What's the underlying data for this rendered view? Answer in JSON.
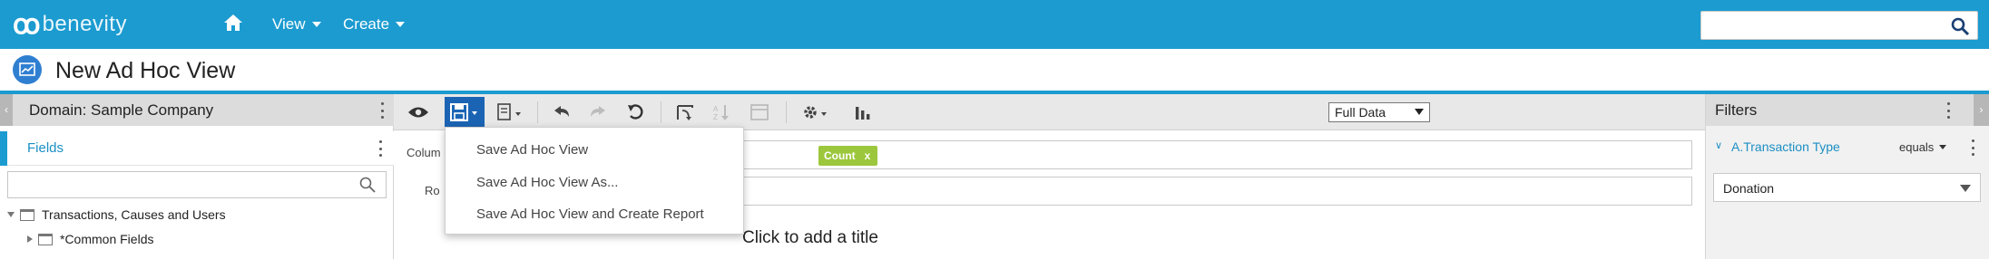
{
  "header": {
    "brand": "benevity",
    "nav": [
      {
        "label": "View"
      },
      {
        "label": "Create"
      }
    ],
    "search": {
      "placeholder": "",
      "value": ""
    }
  },
  "page": {
    "title": "New Ad Hoc View"
  },
  "left_panel": {
    "domain_label": "Domain: Sample Company",
    "fields_label": "Fields",
    "field_search": {
      "placeholder": "",
      "value": ""
    },
    "tree": [
      {
        "label": "Transactions, Causes and Users",
        "expanded": true,
        "level": 0
      },
      {
        "label": "*Common Fields",
        "expanded": false,
        "level": 1
      }
    ]
  },
  "toolbar": {
    "data_mode": "Full Data"
  },
  "canvas": {
    "columns_label": "Colum",
    "rows_label": "Ro",
    "column_pill": "Count",
    "pill_remove": "x",
    "title_placeholder": "Click to add a title"
  },
  "save_menu": {
    "items": [
      {
        "label": "Save Ad Hoc View"
      },
      {
        "label": "Save Ad Hoc View As..."
      },
      {
        "label": "Save Ad Hoc View and Create Report"
      }
    ]
  },
  "filters_panel": {
    "title": "Filters",
    "filter": {
      "field": "A.Transaction Type",
      "operator": "equals",
      "value": "Donation"
    }
  },
  "colors": {
    "primary": "#1b9bd0",
    "active_tool": "#1b64b4",
    "pill": "#9cc73c",
    "link": "#1b8fc4"
  }
}
